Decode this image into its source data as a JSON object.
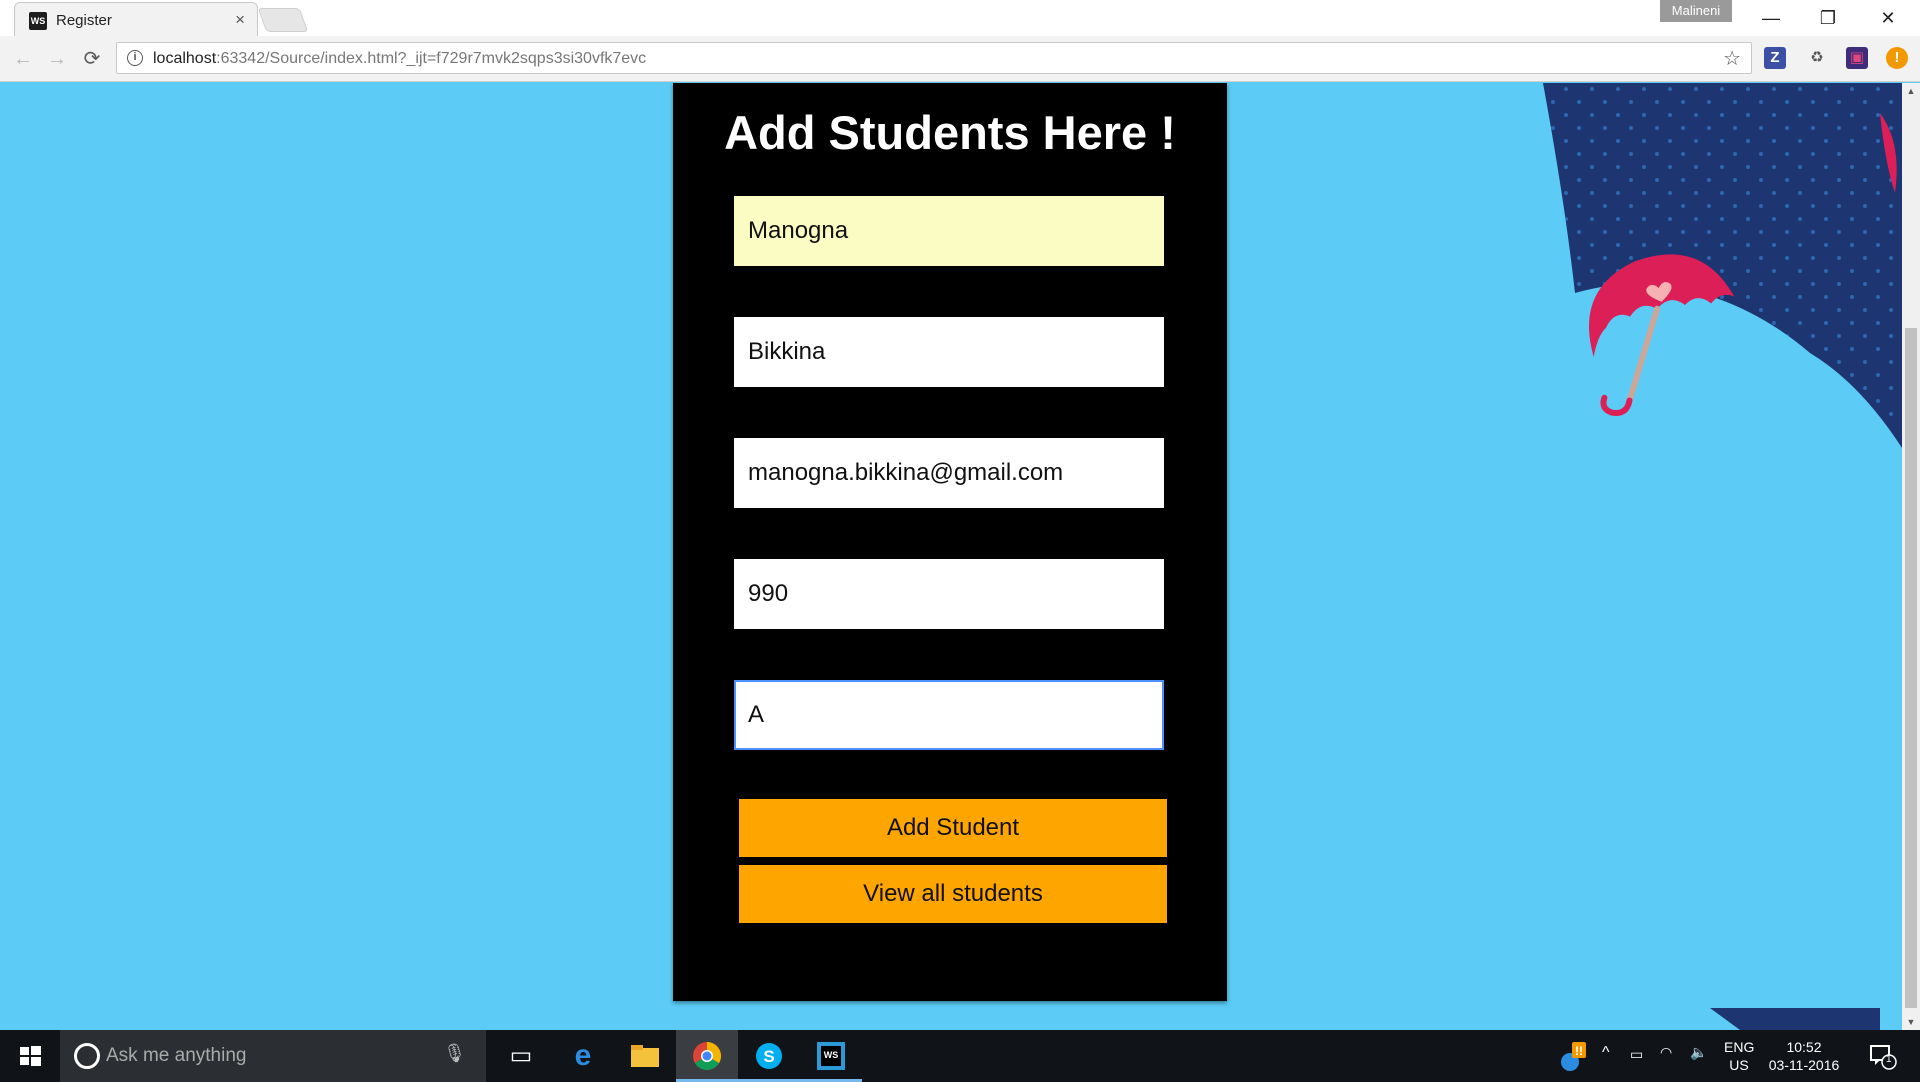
{
  "browser": {
    "tab_title": "Register",
    "tab_favicon": "WS",
    "tab_close": "×",
    "profile_name": "Malineni",
    "url_host": "localhost",
    "url_rest": ":63342/Source/index.html?_ijt=f729r7mvk2sqps3si30vfk7evc",
    "window_controls": {
      "minimize": "—",
      "restore": "❐",
      "close": "✕"
    },
    "nav": {
      "back": "←",
      "forward": "→",
      "reload": "⟳"
    },
    "bookmark_star": "☆",
    "extensions": [
      {
        "name": "z-extension-icon",
        "glyph": "Z",
        "bg": "#3c4fa5",
        "color": "#ffffff"
      },
      {
        "name": "recycle-extension-icon",
        "glyph": "♻",
        "bg": "transparent",
        "color": "#555555"
      },
      {
        "name": "monitor-extension-icon",
        "glyph": "▣",
        "bg": "#3d2d7a",
        "color": "#e0457b"
      },
      {
        "name": "alert-extension-icon",
        "glyph": "!",
        "bg": "#f29900",
        "color": "#ffffff"
      }
    ]
  },
  "form": {
    "heading": "Add Students Here !",
    "fields": [
      {
        "name": "first-name-input",
        "value": "Manogna",
        "autofill": true,
        "focused": false
      },
      {
        "name": "last-name-input",
        "value": "Bikkina",
        "autofill": false,
        "focused": false
      },
      {
        "name": "email-input",
        "value": "manogna.bikkina@gmail.com",
        "autofill": false,
        "focused": false
      },
      {
        "name": "number-input",
        "value": "990",
        "autofill": false,
        "focused": false
      },
      {
        "name": "grade-input",
        "value": "A",
        "autofill": false,
        "focused": true
      }
    ],
    "buttons": {
      "add": "Add Student",
      "view_all": "View all students"
    },
    "colors": {
      "panel": "#000000",
      "button": "#ffa500",
      "page_bg": "#5ccbf6",
      "autofill": "#fafcc4"
    }
  },
  "decor": {
    "umbrella": "umbrella-illustration",
    "umbrella_color": "#dc1f57",
    "dark_shape_color": "#1d3570"
  },
  "taskbar": {
    "search_placeholder": "Ask me anything",
    "tray": {
      "lang_top": "ENG",
      "lang_bottom": "US",
      "time": "10:52",
      "date": "03-11-2016",
      "notifications": "1"
    }
  }
}
